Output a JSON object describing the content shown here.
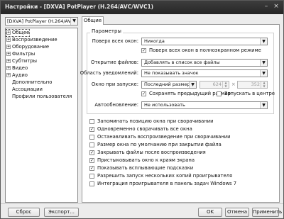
{
  "window": {
    "title": "Настройки - [DXVA] PotPlayer (H.264/AVC/WVC1)"
  },
  "left": {
    "profile_combo": "[DXVA] PotPlayer (H.264/AVC...",
    "tree": [
      {
        "label": "Общее",
        "expandable": true,
        "selected": true
      },
      {
        "label": "Воспроизведение",
        "expandable": true
      },
      {
        "label": "Оборудование",
        "expandable": true
      },
      {
        "label": "Фильтры",
        "expandable": true
      },
      {
        "label": "Субтитры",
        "expandable": true
      },
      {
        "label": "Видео",
        "expandable": true
      },
      {
        "label": "Аудио",
        "expandable": true
      },
      {
        "label": "Дополнительно",
        "expandable": false
      },
      {
        "label": "Ассоциации",
        "expandable": false
      },
      {
        "label": "Профили пользователя",
        "expandable": false
      }
    ]
  },
  "tab": {
    "label": "Общие"
  },
  "params": {
    "group_title": "Параметры",
    "on_top_label": "Поверх всех окон:",
    "on_top_value": "Никогда",
    "on_top_fullscreen": {
      "label": "Поверх всех окон в полноэкранном режиме",
      "checked": true
    },
    "open_files_label": "Открытие файлов:",
    "open_files_value": "Добавлять в список все файлы",
    "notify_label": "Область уведомлений:",
    "notify_value": "Не показывать значок",
    "startup_window_label": "Окно при запуске:",
    "startup_window_value": "Последний размер",
    "width": "624",
    "height": "352",
    "times": "×",
    "keep_size": {
      "label": "Сохранять предыдущий размер",
      "checked": true
    },
    "center": {
      "label": "Запускать в центре",
      "checked": false
    },
    "autoupdate_label": "Автообновление:",
    "autoupdate_value": "Не использовать"
  },
  "options": [
    {
      "label": "Запоминать позицию окна при сворачивании",
      "checked": false
    },
    {
      "label": "Одновременно сворачивать все окна",
      "checked": true
    },
    {
      "label": "Останавливать воспроизведение при сворачивании",
      "checked": false
    },
    {
      "label": "Размер окна по умолчанию при закрытии файла",
      "checked": false
    },
    {
      "label": "Закрывать файлы после воспроизведения",
      "checked": true
    },
    {
      "label": "Пристыковывать окно к краям экрана",
      "checked": true
    },
    {
      "label": "Показывать всплывающие подсказки",
      "checked": true
    },
    {
      "label": "Разрешить запуск нескольких копий проигрывателя",
      "checked": false
    },
    {
      "label": "Интеграция проигрывателя в панель задач Windows 7",
      "checked": false
    }
  ],
  "buttons": {
    "reset": "Сброс",
    "export": "Экспорт...",
    "ok": "OK",
    "cancel": "Отмена",
    "apply": "Применить"
  },
  "glyphs": {
    "check": "✓",
    "plus": "+",
    "arrow_down": "▼",
    "spin_up": "▲",
    "spin_down": "▼",
    "minimize": "–",
    "close": "×"
  }
}
